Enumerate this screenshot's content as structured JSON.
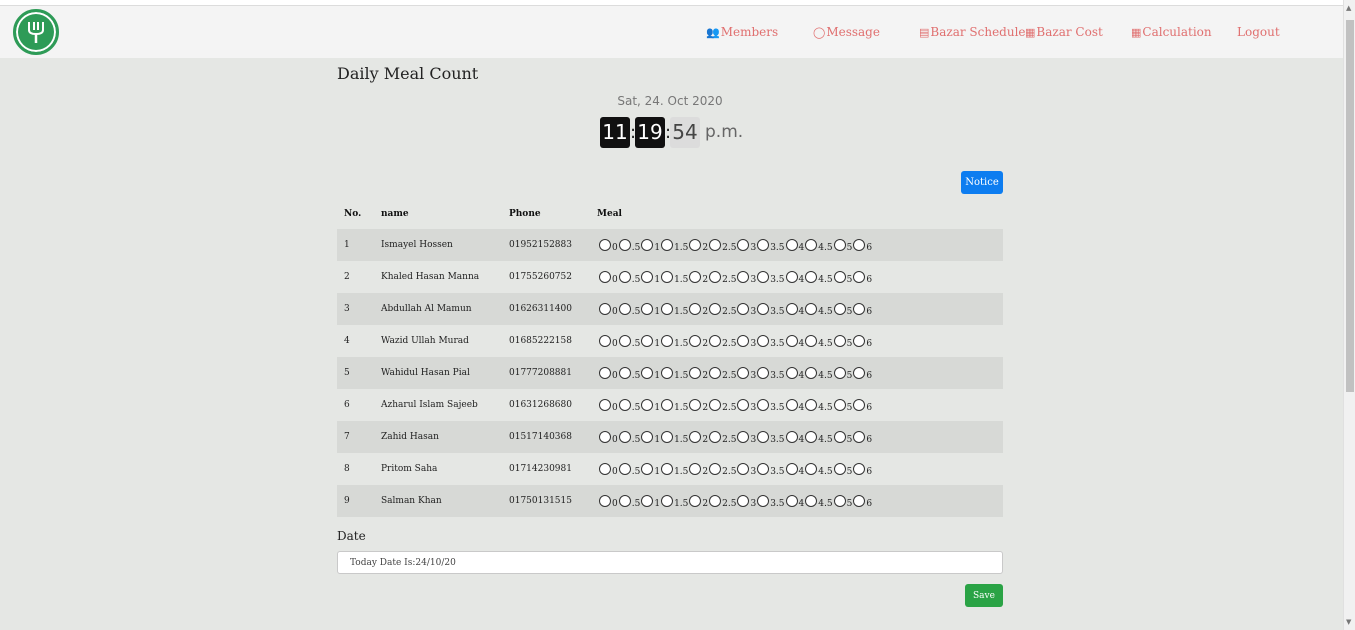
{
  "nav": {
    "links": [
      {
        "label": "Members",
        "icon": "users-icon"
      },
      {
        "label": "Message",
        "icon": "chat-icon"
      },
      {
        "label": "Bazar Schedule",
        "icon": "list-icon"
      },
      {
        "label": "Bazar Cost",
        "icon": "grid-icon"
      },
      {
        "label": "Calculation",
        "icon": "calculator-icon"
      },
      {
        "label": "Logout",
        "icon": ""
      }
    ],
    "link_color": "#e06f6f"
  },
  "page": {
    "title": "Daily Meal Count",
    "date": "Sat, 24. Oct 2020",
    "clock": {
      "hours": "11",
      "minutes": "19",
      "seconds": "54",
      "ampm": "p.m."
    }
  },
  "notice_button": "Notice",
  "table": {
    "headers": {
      "no": "No.",
      "name": "name",
      "phone": "Phone",
      "meal": "Meal"
    },
    "meal_options": [
      "0",
      ".5",
      "1",
      "1.5",
      "2",
      "2.5",
      "3",
      "3.5",
      "4",
      "4.5",
      "5",
      "6"
    ],
    "rows": [
      {
        "no": "1",
        "name": "Ismayel Hossen",
        "phone": "01952152883"
      },
      {
        "no": "2",
        "name": "Khaled Hasan Manna",
        "phone": "01755260752"
      },
      {
        "no": "3",
        "name": "Abdullah Al Mamun",
        "phone": "01626311400"
      },
      {
        "no": "4",
        "name": "Wazid Ullah Murad",
        "phone": "01685222158"
      },
      {
        "no": "5",
        "name": "Wahidul Hasan Pial",
        "phone": "01777208881"
      },
      {
        "no": "6",
        "name": "Azharul Islam Sajeeb",
        "phone": "01631268680"
      },
      {
        "no": "7",
        "name": "Zahid Hasan",
        "phone": "01517140368"
      },
      {
        "no": "8",
        "name": "Pritom Saha",
        "phone": "01714230981"
      },
      {
        "no": "9",
        "name": "Salman Khan",
        "phone": "01750131515"
      }
    ]
  },
  "date_field": {
    "label": "Date",
    "value": "Today Date Is:24/10/20"
  },
  "save_button": "Save",
  "colors": {
    "notice": "#0d7df0",
    "save": "#2aa345",
    "logo": "#2e9b57"
  }
}
